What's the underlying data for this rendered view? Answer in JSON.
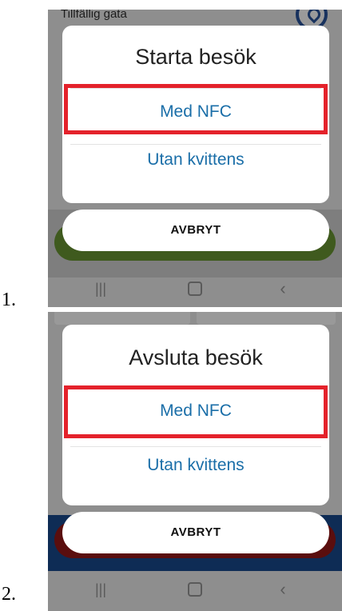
{
  "steps": [
    {
      "number": "1.",
      "background": {
        "street_label": "Tillfällig gata",
        "icon": "location-pin-icon"
      },
      "dialog": {
        "title": "Starta besök",
        "options": [
          "Med NFC",
          "Utan kvittens"
        ],
        "highlighted_option": "Med NFC",
        "cancel_label": "AVBRYT"
      },
      "navbar": {
        "recents": "recent-apps-icon",
        "home": "home-icon",
        "back": "back-icon"
      }
    },
    {
      "number": "2.",
      "dialog": {
        "title": "Avsluta besök",
        "options": [
          "Med NFC",
          "Utan kvittens"
        ],
        "highlighted_option": "Med NFC",
        "cancel_label": "AVBRYT"
      },
      "navbar": {
        "recents": "recent-apps-icon",
        "home": "home-icon",
        "back": "back-icon"
      }
    }
  ],
  "colors": {
    "highlight": "#e4222b",
    "option_text": "#1a6ea8",
    "scrim": "#8e8e8e",
    "start_button_bg": "#3f5a1e",
    "end_button_bg": "#5a0e0e",
    "bottom_band_2": "#0e2c55"
  }
}
